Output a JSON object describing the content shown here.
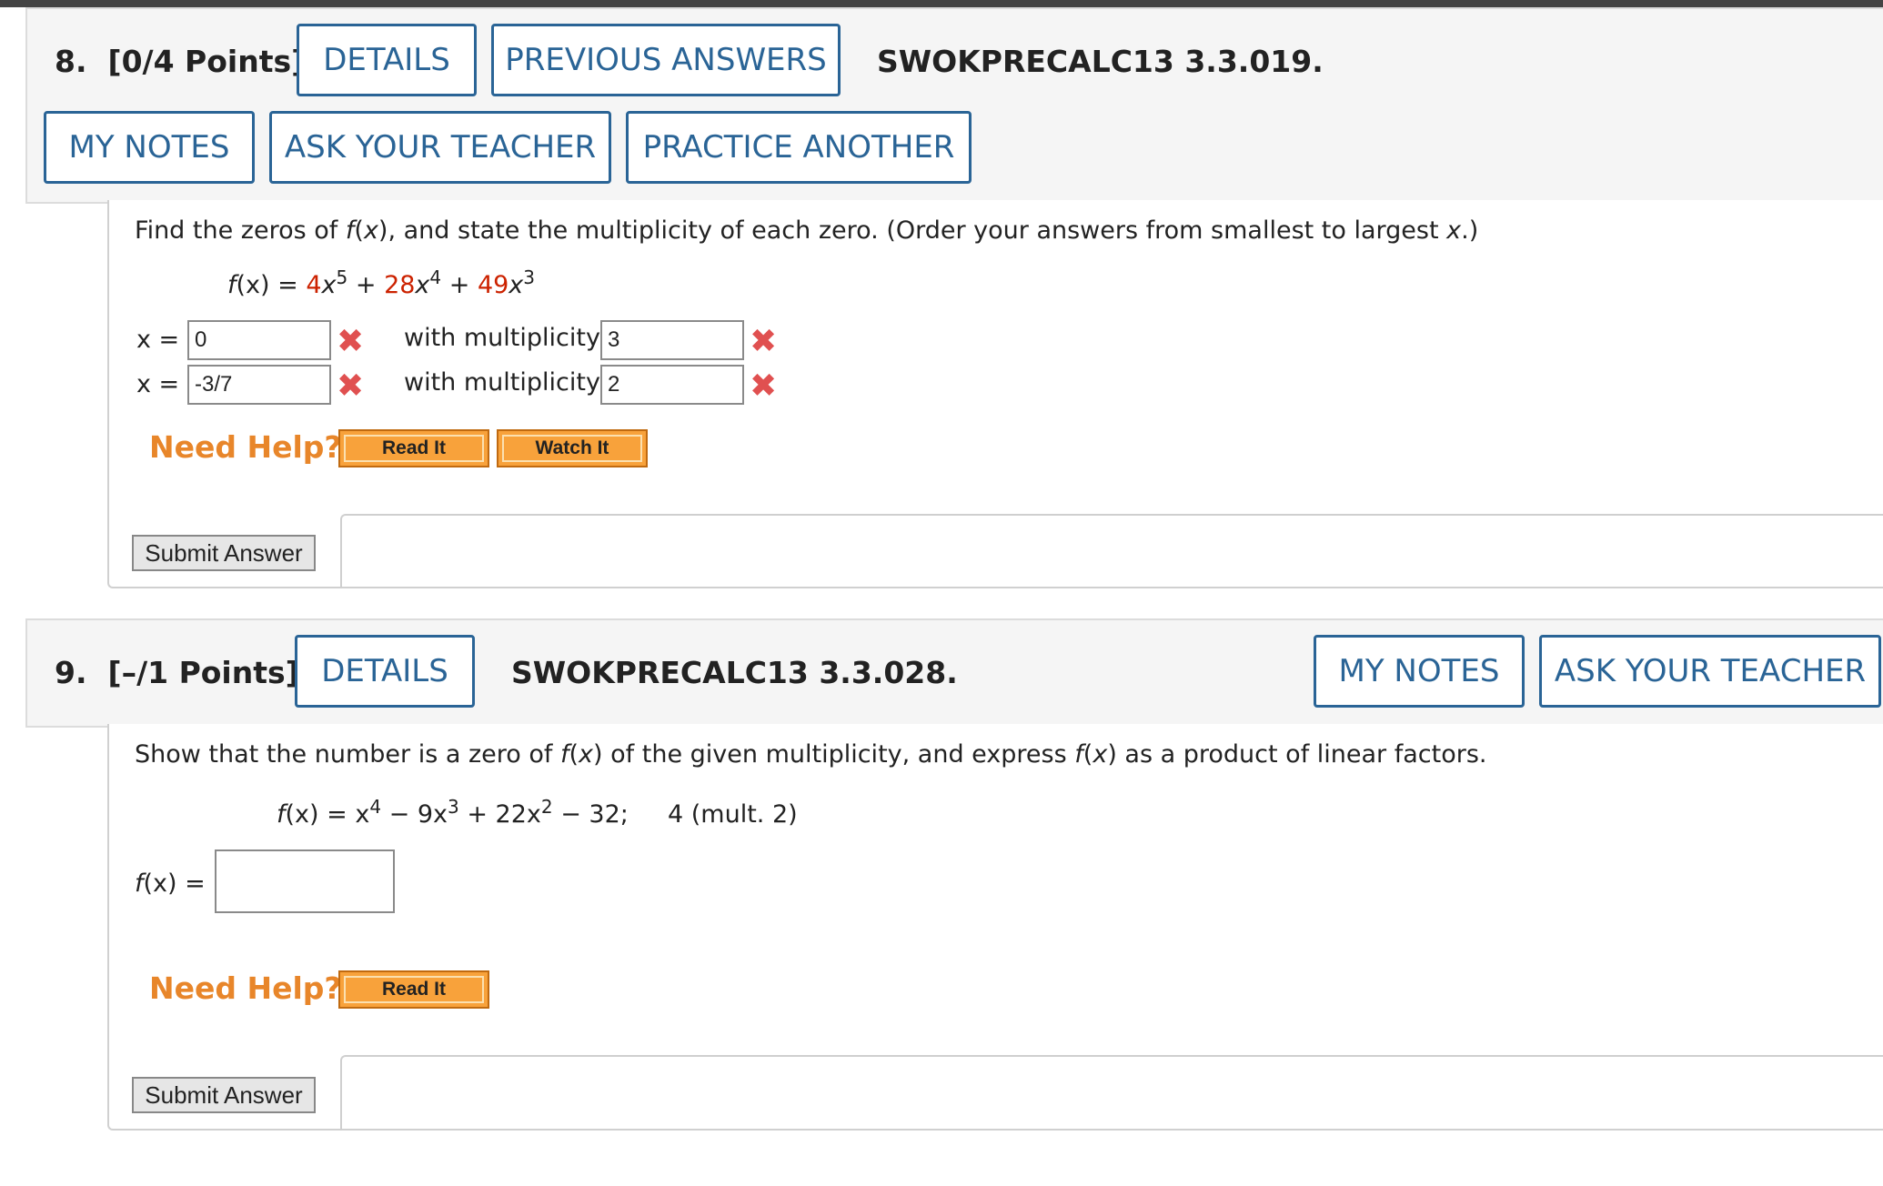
{
  "q8": {
    "number": "8.",
    "points": "[0/4 Points]",
    "buttons": {
      "details": "DETAILS",
      "previous_answers": "PREVIOUS ANSWERS",
      "my_notes": "MY NOTES",
      "ask_teacher": "ASK YOUR TEACHER",
      "practice_another": "PRACTICE ANOTHER"
    },
    "code": "SWOKPRECALC13 3.3.019.",
    "prompt": {
      "t1": "Find the zeros of ",
      "f": "f",
      "t2": "(",
      "x": "x",
      "t3": "), and state the multiplicity of each zero. (Order your answers from smallest to largest ",
      "x2": "x",
      "t4": ".)"
    },
    "equation": {
      "lhs_f": "f",
      "lhs_rest": "(x) = ",
      "c1": "4",
      "x1": "x",
      "e1": "5",
      "plus1": " + ",
      "c2": "28",
      "x2": "x",
      "e2": "4",
      "plus2": " + ",
      "c3": "49",
      "x3": "x",
      "e3": "3"
    },
    "answers": [
      {
        "x_label": "x = ",
        "x_value": "0",
        "mult_label": "with multiplicity",
        "mult_value": "3"
      },
      {
        "x_label": "x = ",
        "x_value": "-3/7",
        "mult_label": "with multiplicity",
        "mult_value": "2"
      }
    ],
    "need_help": "Need Help?",
    "read_it": "Read It",
    "watch_it": "Watch It",
    "submit": "Submit Answer"
  },
  "q9": {
    "number": "9.",
    "points": "[–/1 Points]",
    "buttons": {
      "details": "DETAILS",
      "my_notes": "MY NOTES",
      "ask_teacher": "ASK YOUR TEACHER"
    },
    "code": "SWOKPRECALC13 3.3.028.",
    "prompt": {
      "t1": "Show that the number is a zero of ",
      "f": "f",
      "t2": "(",
      "x": "x",
      "t3": ") of the given multiplicity, and express ",
      "f2": "f",
      "t4": "(",
      "x2": "x",
      "t5": ") as a product of linear factors."
    },
    "equation": {
      "lhs_f": "f",
      "lhs_rest": "(x) = x",
      "e1": "4",
      "t1": " − 9x",
      "e2": "3",
      "t2": " + 22x",
      "e3": "2",
      "t3": " − 32;",
      "zero": "4 (mult. 2)"
    },
    "answer_label_f": "f",
    "answer_label_rest": "(x)  =",
    "answer_value": "",
    "need_help": "Need Help?",
    "read_it": "Read It",
    "submit": "Submit Answer"
  },
  "colors": {
    "button_blue": "#2a6496",
    "highlight_red": "#cc2200",
    "wrong_mark": "#e05050",
    "help_orange": "#e8862a",
    "help_button": "#f8a23b"
  },
  "icons": {
    "wrong": "✖"
  }
}
